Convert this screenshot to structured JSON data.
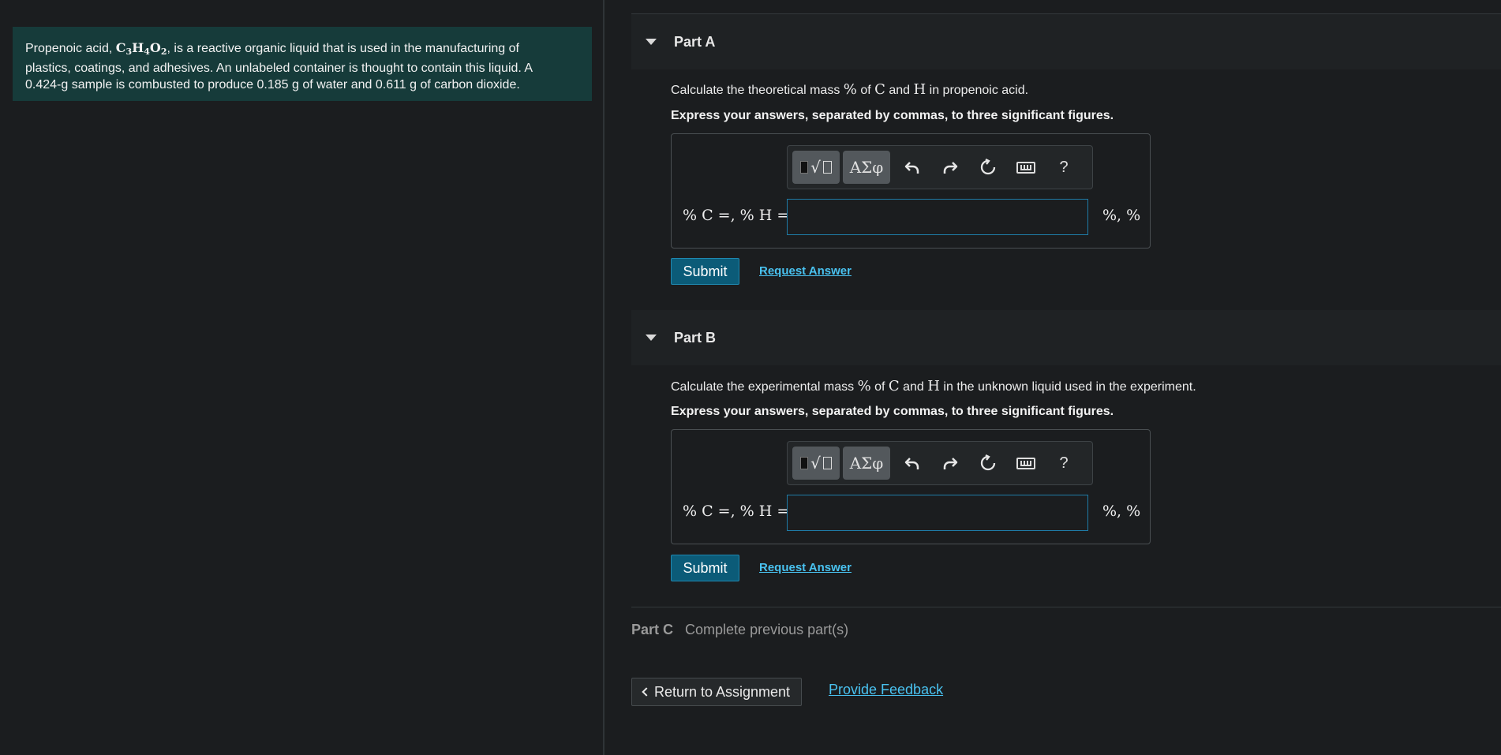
{
  "intro": {
    "line1_pre": "Propenoic acid, ",
    "formula": [
      "C",
      "3",
      "H",
      "4",
      "O",
      "2"
    ],
    "line1_post": ", is a reactive organic liquid that is used in the manufacturing of",
    "line2": "plastics, coatings, and adhesives. An unlabeled container is thought to contain this liquid. A",
    "line3_mass": "0.424-g",
    "line3_a": " sample is combusted to produce ",
    "water_mass": "0.185 g",
    "line3_b": " of water and ",
    "co2_mass": "0.611 g",
    "line3_c": " of carbon dioxide."
  },
  "partA": {
    "title": "Part A",
    "prompt_a": "Calculate the theoretical mass ",
    "pct": "%",
    "prompt_b": " of ",
    "c": "C",
    "and": " and ",
    "h": "H",
    "prompt_c": " in propenoic acid.",
    "instruction": "Express your answers, separated by commas, to three significant figures.",
    "eq_label": "% C =, % H =",
    "unit": "%, %",
    "input_value": "",
    "submit": "Submit",
    "request": "Request Answer"
  },
  "partB": {
    "title": "Part B",
    "prompt_a": "Calculate the experimental mass ",
    "pct": "%",
    "prompt_b": " of ",
    "c": "C",
    "and": " and ",
    "h": "H",
    "prompt_c": " in the unknown liquid used in the experiment.",
    "instruction": "Express your answers, separated by commas, to three significant figures.",
    "eq_label": "% C =, % H =",
    "unit": "%, %",
    "input_value": "",
    "submit": "Submit",
    "request": "Request Answer"
  },
  "toolbar": {
    "greek": "ΑΣφ",
    "help": "?",
    "icons": [
      "templates-icon",
      "greek-symbols-icon",
      "undo-icon",
      "redo-icon",
      "reset-icon",
      "keyboard-icon",
      "help-icon"
    ]
  },
  "partC": {
    "label": "Part C",
    "status": "Complete previous part(s)"
  },
  "footer": {
    "return": "Return to Assignment",
    "feedback": "Provide Feedback"
  },
  "colors": {
    "background": "#1b1d1f",
    "intro_bg": "#163b3a",
    "accent_link": "#49c2f0",
    "submit_bg": "#0b5b78"
  }
}
